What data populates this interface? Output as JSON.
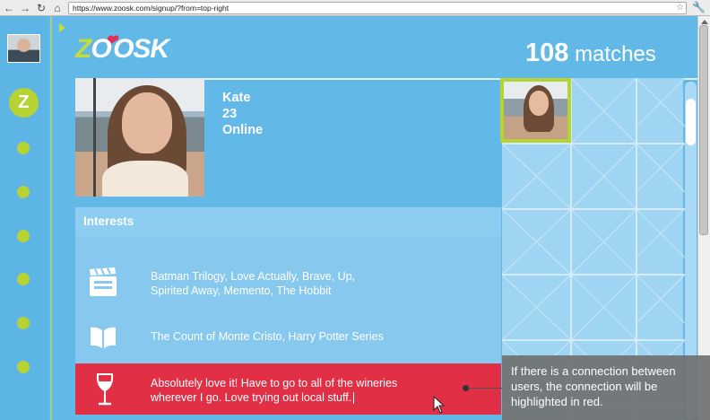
{
  "browser": {
    "url": "https://www.zoosk.com/signup/?from=top-right",
    "back_icon": "arrow-left-icon",
    "forward_icon": "arrow-right-icon",
    "reload_icon": "reload-icon",
    "home_icon": "home-icon",
    "bookmark_icon": "star-icon",
    "menu_icon": "wrench-icon"
  },
  "sidebar": {
    "badge_letter": "Z",
    "nav_dot_count": 6
  },
  "header": {
    "logo_parts": [
      "Z",
      "O",
      "O",
      "SK"
    ],
    "match_count": "108",
    "match_label": "matches"
  },
  "profile": {
    "name": "Kate",
    "age": "23",
    "status": "Online"
  },
  "interests": {
    "title": "Interests",
    "items": [
      {
        "icon": "film-clapper-icon",
        "text_line1": "Batman Trilogy, Love Actually, Brave, Up,",
        "text_line2": "Spirited Away, Memento, The Hobbit"
      },
      {
        "icon": "open-book-icon",
        "text_line1": "The Count of Monte Cristo, Harry Potter Series"
      },
      {
        "icon": "wine-glass-icon",
        "text_line1": "Absolutely love it! Have to go to all of the wineries",
        "text_line2": "wherever I go. Love trying out local stuff."
      }
    ]
  },
  "annotation": {
    "text_line1": "If there is a connection between",
    "text_line2": "users, the connection will be",
    "text_line3": "highlighted in red."
  },
  "colors": {
    "background": "#62b9e8",
    "accent_green": "#b7d233",
    "highlight_red": "#e13046",
    "heart_pink": "#e0305a"
  }
}
